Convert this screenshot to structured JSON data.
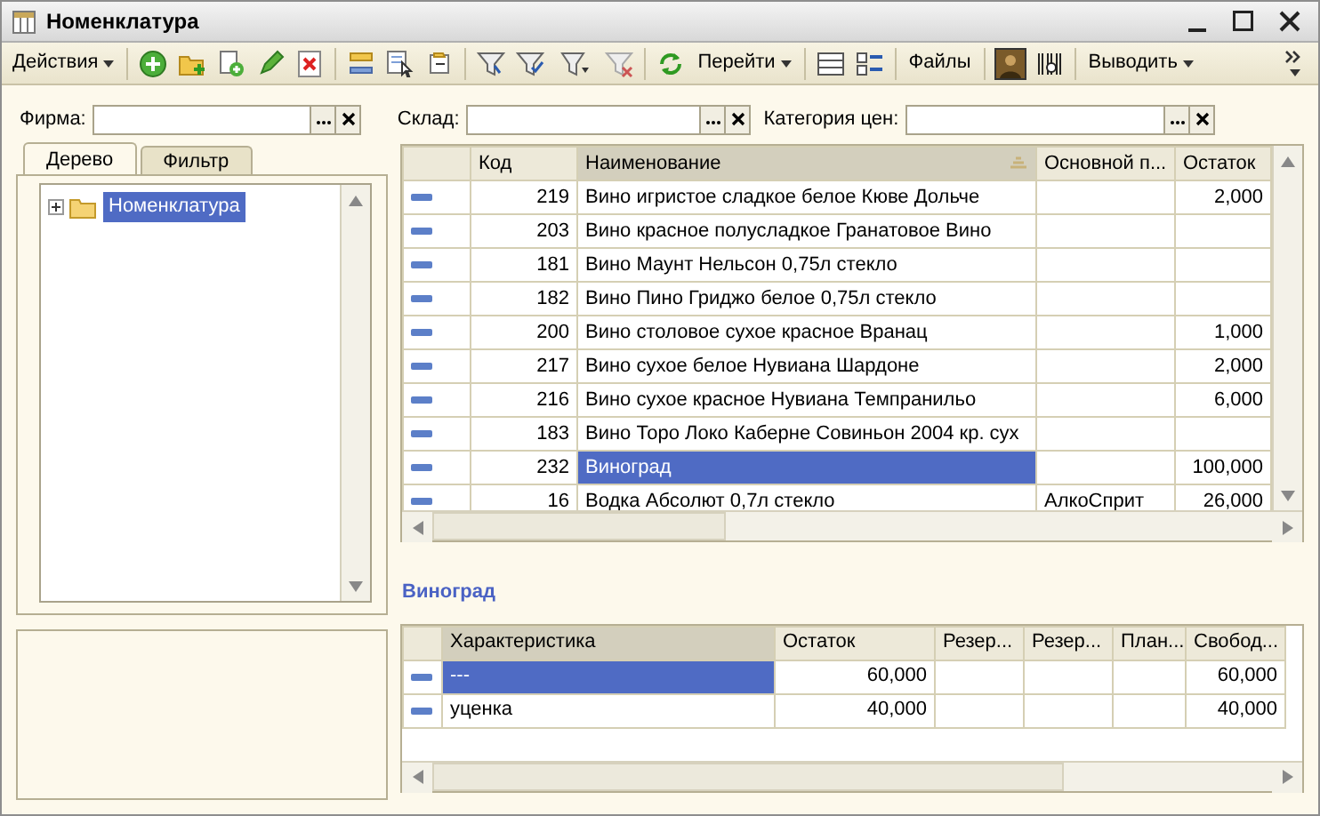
{
  "window": {
    "title": "Номенклатура"
  },
  "toolbar": [
    {
      "kind": "menu",
      "label": "Действия"
    },
    {
      "kind": "menu",
      "label": "Перейти"
    },
    {
      "kind": "button",
      "label": "Файлы"
    },
    {
      "kind": "menu",
      "label": "Выводить"
    }
  ],
  "filters": [
    {
      "label": "Фирма:"
    },
    {
      "label": "Склад:"
    },
    {
      "label": "Категория цен:"
    }
  ],
  "tabs": [
    {
      "label": "Дерево",
      "selected": true
    },
    {
      "label": "Фильтр",
      "selected": false
    }
  ],
  "tree": [
    {
      "label": "Номенклатура",
      "selected": true,
      "expanded": false
    }
  ],
  "table": {
    "columns": [
      {
        "label": "Код",
        "sorted": false
      },
      {
        "label": "Наименование",
        "sorted": true
      },
      {
        "label": "Основной п...",
        "sorted": false
      },
      {
        "label": "Остаток",
        "sorted": false
      }
    ],
    "rows": [
      {
        "code": "219",
        "name": "Вино игристое сладкое белое Кюве Дольче",
        "supplier": "",
        "balance": "2,000",
        "selected": false
      },
      {
        "code": "203",
        "name": "Вино красное полусладкое Гранатовое Вино",
        "supplier": "",
        "balance": "",
        "selected": false
      },
      {
        "code": "181",
        "name": "Вино Маунт Нельсон 0,75л стекло",
        "supplier": "",
        "balance": "",
        "selected": false
      },
      {
        "code": "182",
        "name": "Вино Пино Гриджо белое 0,75л стекло",
        "supplier": "",
        "balance": "",
        "selected": false
      },
      {
        "code": "200",
        "name": "Вино столовое сухое красное Вранац",
        "supplier": "",
        "balance": "1,000",
        "selected": false
      },
      {
        "code": "217",
        "name": "Вино сухое белое Нувиана Шардоне",
        "supplier": "",
        "balance": "2,000",
        "selected": false
      },
      {
        "code": "216",
        "name": "Вино сухое красное Нувиана Темпранильо",
        "supplier": "",
        "balance": "6,000",
        "selected": false
      },
      {
        "code": "183",
        "name": "Вино Торо Локо Каберне Совиньон 2004 кр. сух",
        "supplier": "",
        "balance": "",
        "selected": false
      },
      {
        "code": "232",
        "name": "Виноград",
        "supplier": "",
        "balance": "100,000",
        "selected": true
      },
      {
        "code": "16",
        "name": "Водка Абсолют 0,7л стекло",
        "supplier": "АлкоСприт",
        "balance": "26,000",
        "selected": false
      }
    ]
  },
  "detail": {
    "title": "Виноград",
    "columns": [
      "Характеристика",
      "Остаток",
      "Резер...",
      "Резер...",
      "План...",
      "Свобод..."
    ],
    "rows": [
      {
        "cells": [
          "---",
          "60,000",
          "",
          "",
          "",
          "60,000"
        ],
        "selected": true
      },
      {
        "cells": [
          "уценка",
          "40,000",
          "",
          "",
          "",
          "40,000"
        ],
        "selected": false
      }
    ]
  }
}
